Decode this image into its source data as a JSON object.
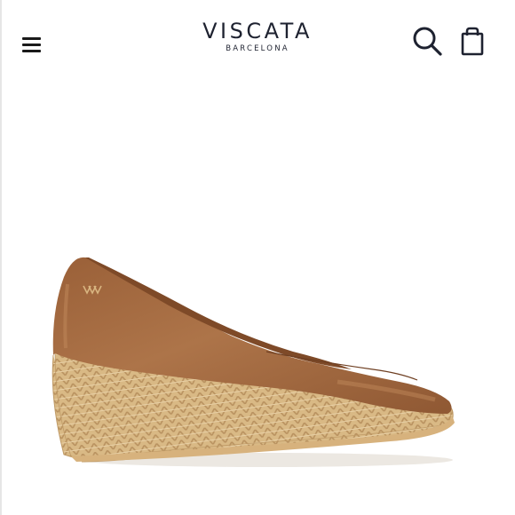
{
  "header": {
    "brand_name": "VISCATA",
    "brand_sub": "BARCELONA",
    "menu_icon": "hamburger-menu-icon",
    "search_icon": "search-icon",
    "bag_icon": "shopping-bag-icon"
  },
  "product": {
    "image_subject": "tan leather espadrille wedge pump",
    "colors": {
      "leather": "#a0683f",
      "jute": "#d8b682"
    }
  }
}
